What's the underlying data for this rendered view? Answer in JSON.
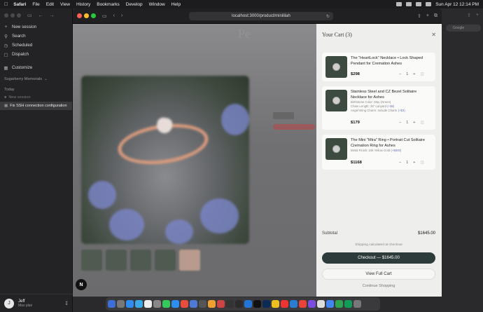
{
  "menubar": {
    "app": "Safari",
    "items": [
      "File",
      "Edit",
      "View",
      "History",
      "Bookmarks",
      "Develop",
      "Window",
      "Help"
    ],
    "clock": "Sun Apr 12  12:14 PM"
  },
  "sidebar": {
    "nav": [
      {
        "icon": "plus-icon",
        "label": "New session"
      },
      {
        "icon": "search-icon",
        "label": "Search"
      },
      {
        "icon": "clock-icon",
        "label": "Scheduled"
      },
      {
        "icon": "dispatch-icon",
        "label": "Dispatch"
      }
    ],
    "customize": "Customize",
    "project": "Sugarberry Memorials",
    "section_today": "Today",
    "sessions": [
      {
        "label": "New session",
        "active": false
      },
      {
        "label": "Fix SSH connection configuration issue",
        "active": true
      }
    ],
    "user": {
      "initial": "J",
      "name": "Jeff",
      "plan": "Max plan"
    }
  },
  "browser": {
    "url": "localhost:3000/product/minililah"
  },
  "page": {
    "logo": "Pe",
    "badge": "N"
  },
  "cart": {
    "title": "Your Cart (3)",
    "items": [
      {
        "name": "The \"HeartLock\" Necklace • Lock Shaped Pendant for Cremation Ashes",
        "options": [],
        "price": "$298",
        "qty": "1"
      },
      {
        "name": "Stainless Steel and CZ Bezel Solitaire Necklace for Ashes",
        "options": [
          {
            "text": "Birthstone Color: May (Green)",
            "add": ""
          },
          {
            "text": "Chain Length: 26\" Lanyard",
            "add": "(+$6)"
          },
          {
            "text": "Angel Wing Charm: Include Charm",
            "add": "(+$3)"
          }
        ],
        "price": "$179",
        "qty": "1"
      },
      {
        "name": "The Mini \"Mira\" Ring • Portrait Cut Solitaire Cremation Ring for Ashes",
        "options": [
          {
            "text": "Metal Finish: 10k Yellow Gold",
            "add": "(+$800)"
          }
        ],
        "price": "$1168",
        "qty": "1"
      }
    ],
    "subtotal_label": "Subtotal",
    "subtotal_value": "$1645.00",
    "shipping_note": "Shipping calculated at checkout",
    "checkout_label": "Checkout — $1645.00",
    "view_cart_label": "View Full Cart",
    "continue_label": "Continue Shopping"
  },
  "right_panel": {
    "search_placeholder": "Google"
  },
  "colors": {
    "checkout_bg": "#2d3c3a",
    "cart_bg": "#eeeeec",
    "option_add": "#6a7db5"
  }
}
